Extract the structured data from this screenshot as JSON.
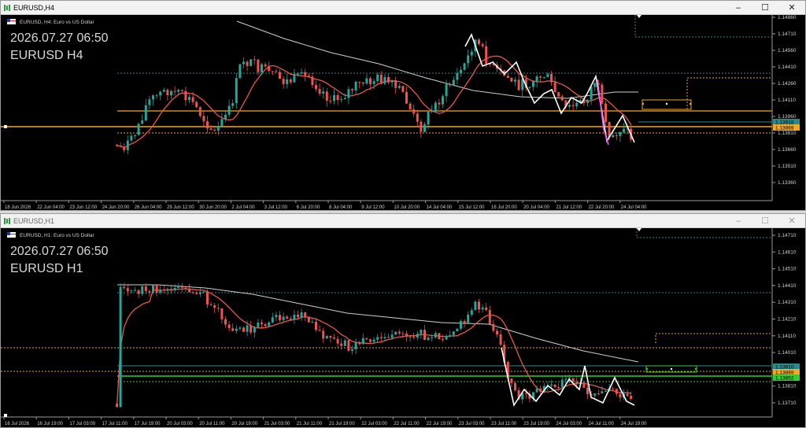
{
  "colors": {
    "background": "#000000",
    "candle_up": "#26a69a",
    "candle_down": "#ef5350",
    "ma_fast": "#e8584a",
    "ma_slow": "#cfcfcf",
    "zigzag": "#ffffff",
    "zigzag_alt": "#ff55ff",
    "level_orange": "#f5a623",
    "level_green": "#33cc33",
    "level_teal": "#2a8a8a",
    "axis_text": "#d0d0d0"
  },
  "charts": [
    {
      "window_title": "EURUSD,H4",
      "info_label": "EURUSD, H4: Euro vs US Dollar",
      "overlay_time": "2026.07.27 06:50",
      "overlay_symbol": "EURUSD H4",
      "price_axis": [
        "1.14860",
        "1.14710",
        "1.14560",
        "1.14410",
        "1.14260",
        "1.14110",
        "1.13960",
        "1.13810",
        "1.13660",
        "1.13510",
        "1.13360"
      ],
      "time_axis": [
        "18 Jun 2026",
        "22 Jun 04:00",
        "23 Jun 12:00",
        "24 Jun 20:00",
        "26 Jun 04:00",
        "29 Jun 12:00",
        "30 Jun 20:00",
        "2 Jul 04:00",
        "3 Jul 12:00",
        "6 Jul 20:00",
        "8 Jul 04:00",
        "9 Jul 12:00",
        "10 Jul 20:00",
        "14 Jul 04:00",
        "15 Jul 12:00",
        "16 Jul 20:00",
        "20 Jul 04:00",
        "21 Jul 12:00",
        "22 Jul 20:00",
        "24 Jul 04:00"
      ],
      "price_tags": [
        {
          "text": "1.13918",
          "color": "#2a8a8a"
        },
        {
          "text": "1.13869",
          "color": "#f5a623"
        }
      ]
    },
    {
      "window_title": "EURUSD,H1",
      "info_label": "EURUSD, H1: Euro vs US Dollar",
      "overlay_time": "2026.07.27 06:50",
      "overlay_symbol": "EURUSD H1",
      "price_axis": [
        "1.14710",
        "1.14610",
        "1.14510",
        "1.14410",
        "1.14310",
        "1.14210",
        "1.14110",
        "1.14010",
        "1.13910",
        "1.13810",
        "1.13710"
      ],
      "time_axis": [
        "16 Jul 2026",
        "16 Jul 19:00",
        "17 Jul 03:00",
        "17 Jul 11:00",
        "17 Jul 19:00",
        "20 Jul 03:00",
        "20 Jul 11:00",
        "20 Jul 19:00",
        "21 Jul 03:00",
        "21 Jul 11:00",
        "21 Jul 19:00",
        "22 Jul 03:00",
        "22 Jul 11:00",
        "22 Jul 19:00",
        "23 Jul 03:00",
        "23 Jul 11:00",
        "23 Jul 19:00",
        "24 Jul 03:00",
        "24 Jul 11:00",
        "24 Jul 19:00"
      ],
      "price_tags": [
        {
          "text": "1.13910",
          "color": "#2a8a8a"
        },
        {
          "text": "1.13869",
          "color": "#f5a623"
        },
        {
          "text": "1.13852",
          "color": "#33cc33"
        }
      ]
    }
  ]
}
